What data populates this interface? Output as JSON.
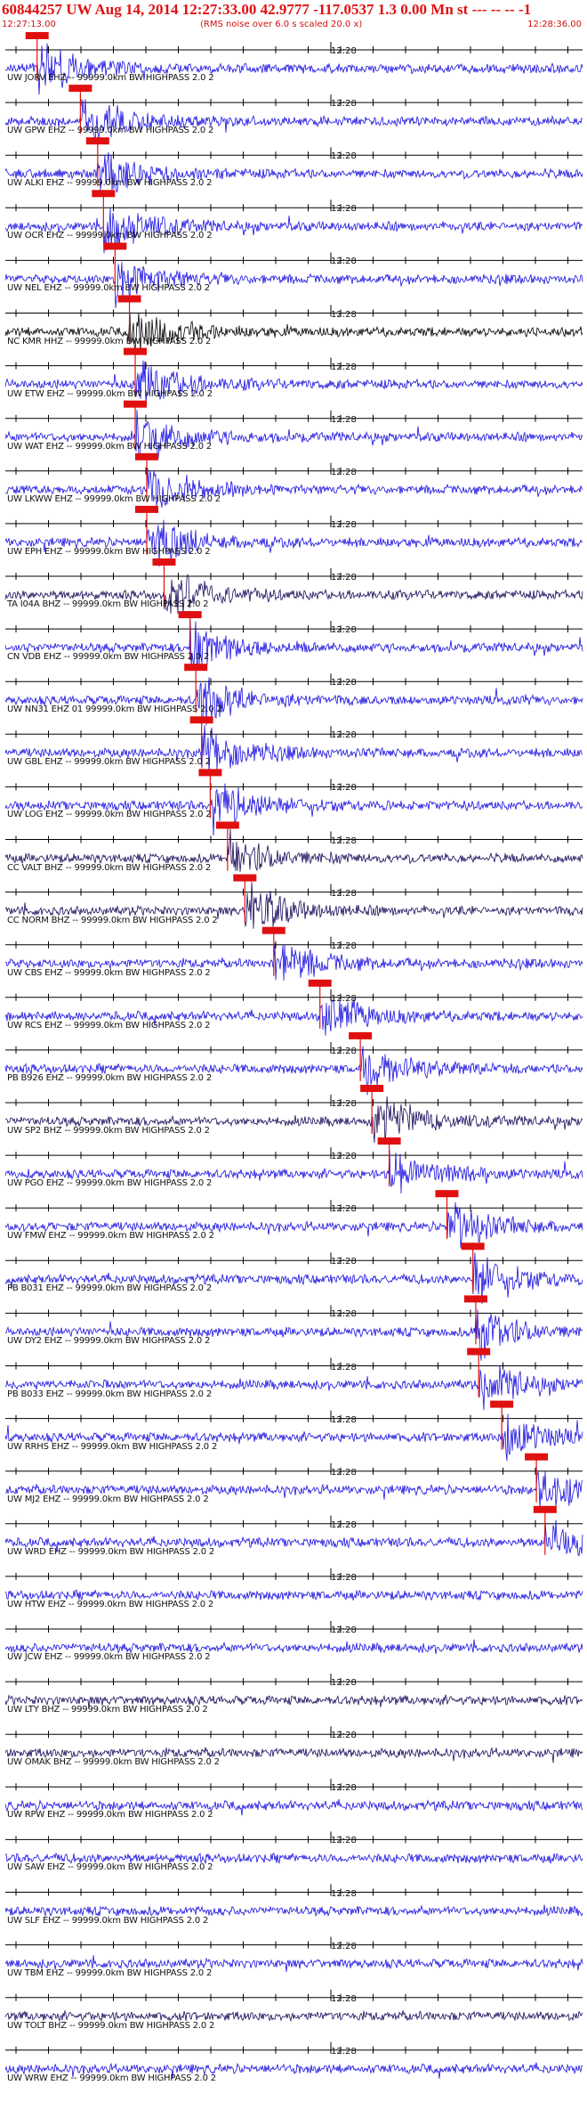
{
  "header": {
    "title": "60844257 UW Aug 14, 2014 12:27:33.00   42.9777 -117.0537  1.3 0.00 Mn st --- -- --  -1",
    "start_time": "12:27:13.00",
    "rms_note": "(RMS noise over 6.0 s scaled 20.0 x)",
    "end_time": "12:28:36.00"
  },
  "tick_label": "12:28",
  "colors": {
    "trace_blue": "#1a10e0",
    "trace_dark": "#1a0a5a",
    "trace_black": "#000000",
    "pick": "#e01010",
    "axis": "#000000"
  },
  "stations": [
    {
      "label": "UW JORV EHZ -- 99999.0km BW  HIGHPASS  2.0  2",
      "color": "trace_blue",
      "pick": 0.055
    },
    {
      "label": "UW GPW EHZ -- 99999.0km BW  HIGHPASS  2.0  2",
      "color": "trace_blue",
      "pick": 0.13
    },
    {
      "label": "UW ALKI EHZ -- 99999.0km BW  HIGHPASS  2.0  2",
      "color": "trace_blue",
      "pick": 0.16
    },
    {
      "label": "UW OCR EHZ -- 99999.0km BW  HIGHPASS  2.0  2",
      "color": "trace_blue",
      "pick": 0.17
    },
    {
      "label": "UW NEL EHZ -- 99999.0km BW  HIGHPASS  2.0  2",
      "color": "trace_blue",
      "pick": 0.19
    },
    {
      "label": "NC KMR HHZ -- 99999.0km BW  HIGHPASS  2.0  2",
      "color": "trace_black",
      "pick": 0.215
    },
    {
      "label": "UW ETW EHZ -- 99999.0km BW  HIGHPASS  2.0  2",
      "color": "trace_blue",
      "pick": 0.225
    },
    {
      "label": "UW WAT EHZ -- 99999.0km BW  HIGHPASS  2.0  2",
      "color": "trace_blue",
      "pick": 0.225
    },
    {
      "label": "UW LKWW EHZ -- 99999.0km BW  HIGHPASS  2.0  2",
      "color": "trace_blue",
      "pick": 0.245
    },
    {
      "label": "UW EPH EHZ -- 99999.0km BW  HIGHPASS  2.0  2",
      "color": "trace_blue",
      "pick": 0.245
    },
    {
      "label": "TA I04A BHZ -- 99999.0km BW  HIGHPASS  2.0  2",
      "color": "trace_dark",
      "pick": 0.275
    },
    {
      "label": "CN VDB EHZ -- 99999.0km BW  HIGHPASS  2.0  2",
      "color": "trace_blue",
      "pick": 0.32
    },
    {
      "label": "UW NN31 EHZ 01 99999.0km BW  HIGHPASS  2.0  2",
      "color": "trace_blue",
      "pick": 0.33
    },
    {
      "label": "UW GBL EHZ -- 99999.0km BW  HIGHPASS  2.0  2",
      "color": "trace_blue",
      "pick": 0.34
    },
    {
      "label": "UW LOG EHZ -- 99999.0km BW  HIGHPASS  2.0  2",
      "color": "trace_blue",
      "pick": 0.355
    },
    {
      "label": "CC VALT BHZ -- 99999.0km BW  HIGHPASS  2.0  2",
      "color": "trace_dark",
      "pick": 0.385
    },
    {
      "label": "CC NORM BHZ -- 99999.0km BW  HIGHPASS  2.0  2",
      "color": "trace_dark",
      "pick": 0.415
    },
    {
      "label": "UW CBS EHZ -- 99999.0km BW  HIGHPASS  2.0  2",
      "color": "trace_blue",
      "pick": 0.465
    },
    {
      "label": "UW RCS EHZ -- 99999.0km BW  HIGHPASS  2.0  2",
      "color": "trace_blue",
      "pick": 0.545
    },
    {
      "label": "PB B926 EHZ -- 99999.0km BW  HIGHPASS  2.0  2",
      "color": "trace_blue",
      "pick": 0.615
    },
    {
      "label": "UW SP2 BHZ -- 99999.0km BW  HIGHPASS  2.0  2",
      "color": "trace_dark",
      "pick": 0.635
    },
    {
      "label": "UW PGO EHZ -- 99999.0km BW  HIGHPASS  2.0  2",
      "color": "trace_blue",
      "pick": 0.665
    },
    {
      "label": "UW FMW EHZ -- 99999.0km BW  HIGHPASS  2.0  2",
      "color": "trace_blue",
      "pick": 0.765
    },
    {
      "label": "PB B031 EHZ -- 99999.0km BW  HIGHPASS  2.0  2",
      "color": "trace_blue",
      "pick": 0.81
    },
    {
      "label": "UW DY2 EHZ -- 99999.0km BW  HIGHPASS  2.0  2",
      "color": "trace_blue",
      "pick": 0.815
    },
    {
      "label": "PB B033 EHZ -- 99999.0km BW  HIGHPASS  2.0  2",
      "color": "trace_blue",
      "pick": 0.82
    },
    {
      "label": "UW RRHS EHZ -- 99999.0km BW  HIGHPASS  2.0  2",
      "color": "trace_blue",
      "pick": 0.86
    },
    {
      "label": "UW MJ2 EHZ -- 99999.0km BW  HIGHPASS  2.0  2",
      "color": "trace_blue",
      "pick": 0.92
    },
    {
      "label": "UW WRD EHZ -- 99999.0km BW  HIGHPASS  2.0  2",
      "color": "trace_blue",
      "pick": 0.935
    },
    {
      "label": "UW HTW EHZ -- 99999.0km BW  HIGHPASS  2.0  2",
      "color": "trace_blue",
      "pick": null
    },
    {
      "label": "UW JCW EHZ -- 99999.0km BW  HIGHPASS  2.0  2",
      "color": "trace_blue",
      "pick": null
    },
    {
      "label": "UW LTY BHZ -- 99999.0km BW  HIGHPASS  2.0  2",
      "color": "trace_dark",
      "pick": null
    },
    {
      "label": "UW OMAK BHZ -- 99999.0km BW  HIGHPASS  2.0  2",
      "color": "trace_dark",
      "pick": null
    },
    {
      "label": "UW RPW EHZ -- 99999.0km BW  HIGHPASS  2.0  2",
      "color": "trace_blue",
      "pick": null
    },
    {
      "label": "UW SAW EHZ -- 99999.0km BW  HIGHPASS  2.0  2",
      "color": "trace_blue",
      "pick": null
    },
    {
      "label": "UW SLF EHZ -- 99999.0km BW  HIGHPASS  2.0  2",
      "color": "trace_blue",
      "pick": null
    },
    {
      "label": "UW TBM EHZ -- 99999.0km BW  HIGHPASS  2.0  2",
      "color": "trace_blue",
      "pick": null
    },
    {
      "label": "UW TOLT BHZ -- 99999.0km BW  HIGHPASS  2.0  2",
      "color": "trace_dark",
      "pick": null
    },
    {
      "label": "UW WRW EHZ -- 99999.0km BW  HIGHPASS  2.0  2",
      "color": "trace_blue",
      "pick": null
    }
  ]
}
